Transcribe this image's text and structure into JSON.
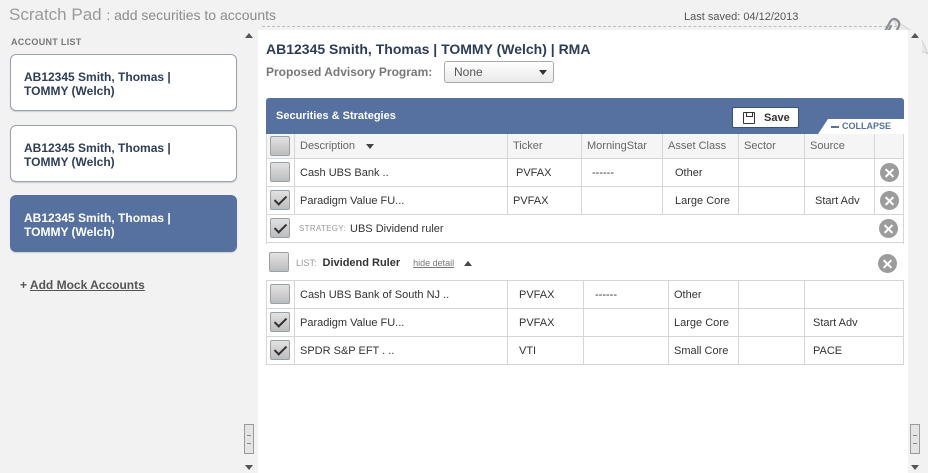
{
  "header": {
    "app_title": "Scratch Pad",
    "app_subtitle": ": add securities to accounts",
    "last_saved": "Last saved: 04/12/2013"
  },
  "sidebar": {
    "label": "ACCOUNT LIST",
    "accounts": [
      {
        "line1": "AB12345 Smith, Thomas |",
        "line2": "TOMMY (Welch)",
        "selected": false
      },
      {
        "line1": "AB12345 Smith, Thomas |",
        "line2": "TOMMY (Welch)",
        "selected": false
      },
      {
        "line1": "AB12345 Smith, Thomas |",
        "line2": "TOMMY (Welch)",
        "selected": true
      }
    ],
    "add_prefix": "+",
    "add_label": "Add Mock Accounts"
  },
  "main": {
    "account_title": "AB12345 Smith, Thomas | TOMMY (Welch) | RMA",
    "program_label": "Proposed Advisory Program:",
    "program_value": "None",
    "section_title": "Securities & Strategies",
    "save_label": "Save",
    "collapse_label": "COLLAPSE",
    "columns": [
      "Description",
      "Ticker",
      "MorningStar",
      "Asset Class",
      "Sector",
      "Source"
    ],
    "top_rows": [
      {
        "description": "Cash UBS Bank ..",
        "ticker": "PVFAX",
        "morningstar": "------",
        "asset_class": "Other",
        "sector": "",
        "source": "",
        "checked": false
      },
      {
        "description": "Paradigm Value FU...",
        "ticker": "PVFAX",
        "morningstar": "",
        "asset_class": "Large Core",
        "sector": "",
        "source": "Start Adv",
        "checked": true
      }
    ],
    "strategy": {
      "label": "STRATEGY:",
      "name": "UBS Dividend ruler",
      "checked": true
    },
    "list": {
      "label": "LIST:",
      "name": "Dividend Ruler",
      "hide_label": "hide detail"
    },
    "list_rows": [
      {
        "description": "Cash UBS Bank of South NJ ..",
        "ticker": "PVFAX",
        "morningstar": "------",
        "asset_class": "Other",
        "sector": "",
        "source": "",
        "checked": false
      },
      {
        "description": "Paradigm Value FU...",
        "ticker": "PVFAX",
        "morningstar": "",
        "asset_class": "Large Core",
        "sector": "",
        "source": "Start Adv",
        "checked": true
      },
      {
        "description": "SPDR S&P EFT . ..",
        "ticker": "VTI",
        "morningstar": "",
        "asset_class": "Small Core",
        "sector": "",
        "source": "PACE",
        "checked": true
      }
    ]
  },
  "colors": {
    "accent": "#5670a0",
    "title": "#2e3d57"
  }
}
